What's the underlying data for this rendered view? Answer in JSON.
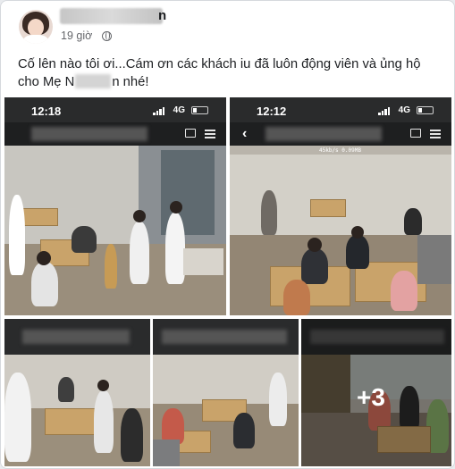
{
  "post": {
    "author_suffix": "n",
    "time": "19 giờ",
    "privacy_icon": "globe-icon",
    "caption_line1": "Cố lên nào tôi ơi...Cám ơn các khách iu đã luôn động viên và ủng hộ",
    "caption_line2_start": "cho Mẹ N",
    "caption_line2_end": "n nhé!"
  },
  "photos": {
    "p1": {
      "clock": "12:18",
      "network": "4G"
    },
    "p2": {
      "clock": "12:12",
      "network": "4G",
      "bitrate": "45kb/s 0.09MB"
    },
    "more_count": "+3"
  }
}
